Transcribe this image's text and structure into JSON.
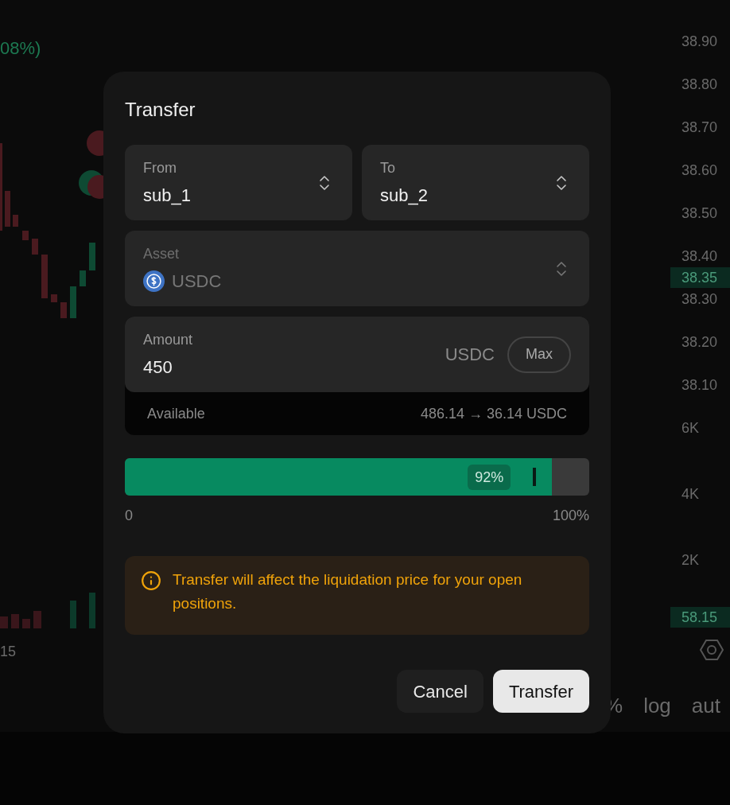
{
  "chart": {
    "change": "08%)",
    "price_axis": [
      "38.90",
      "38.80",
      "38.70",
      "38.60",
      "38.50",
      "38.40",
      "38.30",
      "38.20",
      "38.10"
    ],
    "last_price": "38.35",
    "volume_axis": [
      "6K",
      "4K",
      "2K"
    ],
    "last_volume": "58.15",
    "time_label": "15",
    "controls": [
      "%",
      "log",
      "aut"
    ]
  },
  "dialog": {
    "title": "Transfer",
    "from": {
      "label": "From",
      "value": "sub_1"
    },
    "to": {
      "label": "To",
      "value": "sub_2"
    },
    "asset": {
      "label": "Asset",
      "value": "USDC",
      "disabled": true
    },
    "amount": {
      "label": "Amount",
      "value": "450",
      "unit": "USDC",
      "max": "Max"
    },
    "available": {
      "label": "Available",
      "value": "486.14 → 36.14 USDC"
    },
    "slider": {
      "level": 0.92,
      "reading": "92%",
      "min": "0",
      "max": "100%"
    },
    "warning": "Transfer will affect the liquidation price for your open positions.",
    "buttons": [
      {
        "label": "Cancel",
        "kind": "secondary"
      },
      {
        "label": "Transfer",
        "kind": "primary"
      }
    ]
  }
}
